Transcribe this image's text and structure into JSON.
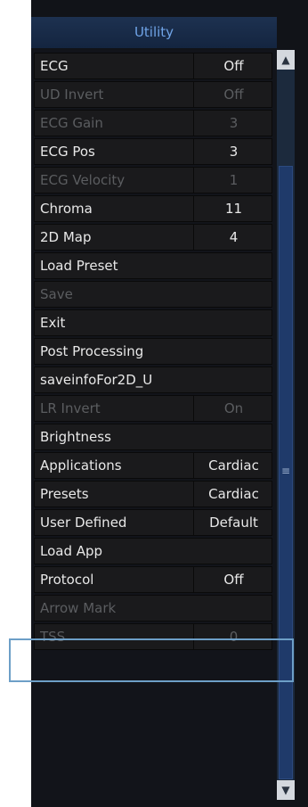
{
  "panel": {
    "title": "Utility"
  },
  "items": [
    {
      "label": "ECG",
      "value": "Off",
      "enabled": true
    },
    {
      "label": "UD Invert",
      "value": "Off",
      "enabled": false
    },
    {
      "label": "ECG Gain",
      "value": "3",
      "enabled": false
    },
    {
      "label": "ECG Pos",
      "value": "3",
      "enabled": true
    },
    {
      "label": "ECG Velocity",
      "value": "1",
      "enabled": false
    },
    {
      "label": "Chroma",
      "value": "11",
      "enabled": true
    },
    {
      "label": "2D Map",
      "value": "4",
      "enabled": true
    },
    {
      "label": "Load Preset",
      "value": "",
      "enabled": true
    },
    {
      "label": "Save",
      "value": "",
      "enabled": false
    },
    {
      "label": "Exit",
      "value": "",
      "enabled": true
    },
    {
      "label": "Post Processing",
      "value": "",
      "enabled": true
    },
    {
      "label": "saveinfoFor2D_U",
      "value": "",
      "enabled": true
    },
    {
      "label": "LR Invert",
      "value": "On",
      "enabled": false
    },
    {
      "label": "Brightness",
      "value": "",
      "enabled": true
    },
    {
      "label": "Applications",
      "value": "Cardiac",
      "enabled": true
    },
    {
      "label": "Presets",
      "value": "Cardiac",
      "enabled": true
    },
    {
      "label": "User Defined",
      "value": "Default",
      "enabled": true
    },
    {
      "label": "Load App",
      "value": "",
      "enabled": true
    },
    {
      "label": "Protocol",
      "value": "Off",
      "enabled": true
    },
    {
      "label": "Arrow Mark",
      "value": "",
      "enabled": false
    },
    {
      "label": "TSS",
      "value": "0",
      "enabled": false
    }
  ],
  "scrollbar": {
    "up_icon": "chevron-up-icon",
    "down_icon": "chevron-down-icon",
    "grip_icon": "grip-lines-icon"
  },
  "colors": {
    "title_text": "#6fa3e6",
    "highlight_border": "#6d9fc7",
    "disabled_text": "#5b5d60"
  }
}
